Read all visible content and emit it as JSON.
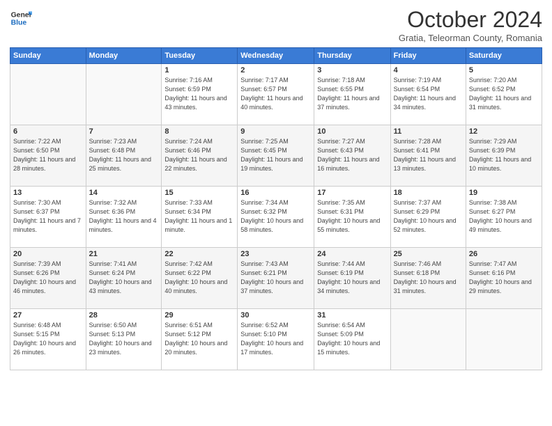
{
  "header": {
    "logo_general": "General",
    "logo_blue": "Blue",
    "month_title": "October 2024",
    "subtitle": "Gratia, Teleorman County, Romania"
  },
  "columns": [
    "Sunday",
    "Monday",
    "Tuesday",
    "Wednesday",
    "Thursday",
    "Friday",
    "Saturday"
  ],
  "weeks": [
    [
      {
        "day": "",
        "detail": ""
      },
      {
        "day": "",
        "detail": ""
      },
      {
        "day": "1",
        "detail": "Sunrise: 7:16 AM\nSunset: 6:59 PM\nDaylight: 11 hours and 43 minutes."
      },
      {
        "day": "2",
        "detail": "Sunrise: 7:17 AM\nSunset: 6:57 PM\nDaylight: 11 hours and 40 minutes."
      },
      {
        "day": "3",
        "detail": "Sunrise: 7:18 AM\nSunset: 6:55 PM\nDaylight: 11 hours and 37 minutes."
      },
      {
        "day": "4",
        "detail": "Sunrise: 7:19 AM\nSunset: 6:54 PM\nDaylight: 11 hours and 34 minutes."
      },
      {
        "day": "5",
        "detail": "Sunrise: 7:20 AM\nSunset: 6:52 PM\nDaylight: 11 hours and 31 minutes."
      }
    ],
    [
      {
        "day": "6",
        "detail": "Sunrise: 7:22 AM\nSunset: 6:50 PM\nDaylight: 11 hours and 28 minutes."
      },
      {
        "day": "7",
        "detail": "Sunrise: 7:23 AM\nSunset: 6:48 PM\nDaylight: 11 hours and 25 minutes."
      },
      {
        "day": "8",
        "detail": "Sunrise: 7:24 AM\nSunset: 6:46 PM\nDaylight: 11 hours and 22 minutes."
      },
      {
        "day": "9",
        "detail": "Sunrise: 7:25 AM\nSunset: 6:45 PM\nDaylight: 11 hours and 19 minutes."
      },
      {
        "day": "10",
        "detail": "Sunrise: 7:27 AM\nSunset: 6:43 PM\nDaylight: 11 hours and 16 minutes."
      },
      {
        "day": "11",
        "detail": "Sunrise: 7:28 AM\nSunset: 6:41 PM\nDaylight: 11 hours and 13 minutes."
      },
      {
        "day": "12",
        "detail": "Sunrise: 7:29 AM\nSunset: 6:39 PM\nDaylight: 11 hours and 10 minutes."
      }
    ],
    [
      {
        "day": "13",
        "detail": "Sunrise: 7:30 AM\nSunset: 6:37 PM\nDaylight: 11 hours and 7 minutes."
      },
      {
        "day": "14",
        "detail": "Sunrise: 7:32 AM\nSunset: 6:36 PM\nDaylight: 11 hours and 4 minutes."
      },
      {
        "day": "15",
        "detail": "Sunrise: 7:33 AM\nSunset: 6:34 PM\nDaylight: 11 hours and 1 minute."
      },
      {
        "day": "16",
        "detail": "Sunrise: 7:34 AM\nSunset: 6:32 PM\nDaylight: 10 hours and 58 minutes."
      },
      {
        "day": "17",
        "detail": "Sunrise: 7:35 AM\nSunset: 6:31 PM\nDaylight: 10 hours and 55 minutes."
      },
      {
        "day": "18",
        "detail": "Sunrise: 7:37 AM\nSunset: 6:29 PM\nDaylight: 10 hours and 52 minutes."
      },
      {
        "day": "19",
        "detail": "Sunrise: 7:38 AM\nSunset: 6:27 PM\nDaylight: 10 hours and 49 minutes."
      }
    ],
    [
      {
        "day": "20",
        "detail": "Sunrise: 7:39 AM\nSunset: 6:26 PM\nDaylight: 10 hours and 46 minutes."
      },
      {
        "day": "21",
        "detail": "Sunrise: 7:41 AM\nSunset: 6:24 PM\nDaylight: 10 hours and 43 minutes."
      },
      {
        "day": "22",
        "detail": "Sunrise: 7:42 AM\nSunset: 6:22 PM\nDaylight: 10 hours and 40 minutes."
      },
      {
        "day": "23",
        "detail": "Sunrise: 7:43 AM\nSunset: 6:21 PM\nDaylight: 10 hours and 37 minutes."
      },
      {
        "day": "24",
        "detail": "Sunrise: 7:44 AM\nSunset: 6:19 PM\nDaylight: 10 hours and 34 minutes."
      },
      {
        "day": "25",
        "detail": "Sunrise: 7:46 AM\nSunset: 6:18 PM\nDaylight: 10 hours and 31 minutes."
      },
      {
        "day": "26",
        "detail": "Sunrise: 7:47 AM\nSunset: 6:16 PM\nDaylight: 10 hours and 29 minutes."
      }
    ],
    [
      {
        "day": "27",
        "detail": "Sunrise: 6:48 AM\nSunset: 5:15 PM\nDaylight: 10 hours and 26 minutes."
      },
      {
        "day": "28",
        "detail": "Sunrise: 6:50 AM\nSunset: 5:13 PM\nDaylight: 10 hours and 23 minutes."
      },
      {
        "day": "29",
        "detail": "Sunrise: 6:51 AM\nSunset: 5:12 PM\nDaylight: 10 hours and 20 minutes."
      },
      {
        "day": "30",
        "detail": "Sunrise: 6:52 AM\nSunset: 5:10 PM\nDaylight: 10 hours and 17 minutes."
      },
      {
        "day": "31",
        "detail": "Sunrise: 6:54 AM\nSunset: 5:09 PM\nDaylight: 10 hours and 15 minutes."
      },
      {
        "day": "",
        "detail": ""
      },
      {
        "day": "",
        "detail": ""
      }
    ]
  ]
}
